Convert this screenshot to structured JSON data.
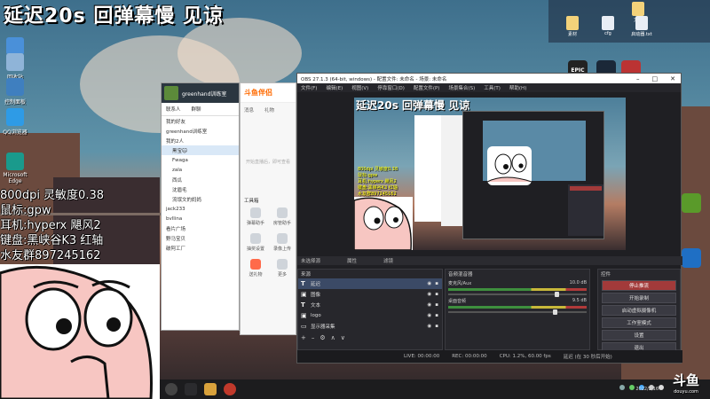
{
  "overlay": {
    "title": "延迟20s 回弹幕慢 见谅",
    "specs": [
      "800dpi 灵敏度0.38",
      "鼠标:gpw",
      "耳机:hyperx 飓风2",
      "键盘:黑峡谷K3 红轴",
      "水友群897245162"
    ]
  },
  "desktop_icons": [
    {
      "label": "此电脑",
      "icon": "computer-icon",
      "color": "#4a90d9"
    },
    {
      "label": "回收站",
      "icon": "recycle-bin-icon",
      "color": "#8fb4d8"
    },
    {
      "label": "控制面板",
      "icon": "control-panel-icon",
      "color": "#3f7fbf"
    },
    {
      "label": "QQ浏览器",
      "icon": "qq-browser-icon",
      "color": "#2e9be6"
    },
    {
      "label": "Microsoft Edge",
      "icon": "edge-icon",
      "color": "#1a9a8c"
    }
  ],
  "tray_files": [
    {
      "label": "文件",
      "icon": "folder-icon"
    },
    {
      "label": "素材",
      "icon": "folder-icon"
    },
    {
      "label": "cfg",
      "icon": "file-icon"
    },
    {
      "label": "启动器.txt",
      "icon": "text-file-icon"
    }
  ],
  "game_icons": [
    {
      "name": "epic-games-icon",
      "label": "EPIC",
      "color": "#222"
    },
    {
      "name": "steam-icon",
      "label": "",
      "color": "#1b2838"
    },
    {
      "name": "game-launcher-icon",
      "label": "",
      "color": "#b33"
    },
    {
      "name": "nvidia-icon",
      "label": "",
      "color": "#5a9a2a"
    },
    {
      "name": "teamviewer-icon",
      "label": "",
      "color": "#1f6fc4"
    }
  ],
  "qq": {
    "name": "greenhand训练室",
    "tabs": [
      "联系人",
      "群聊"
    ],
    "rows": [
      "我的好友",
      "greenhand训练室",
      "我的2人",
      "黑宝🐱",
      "Fwaga",
      "zala",
      "西瓜",
      "沈眉毛",
      "流氓文的妈妈",
      "jack233",
      "bvllina",
      "看片广场",
      "野马宝贝",
      "破阿工厂"
    ]
  },
  "assistant": {
    "logo": "斗鱼伴侣",
    "tabs": [
      "消息",
      "礼物"
    ],
    "placeholder": "开始直播后，即可查看",
    "section": "工具箱",
    "tools": [
      "弹幕助手",
      "房管助手",
      "抽奖设置",
      "录像上传",
      "送礼物",
      "更多"
    ]
  },
  "obs": {
    "title": "OBS 27.1.3 (64-bit, windows) - 配置文件: 未命名 - 场景: 未命名",
    "menu": [
      "文件(F)",
      "编辑(E)",
      "视图(V)",
      "停靠窗口(D)",
      "配置文件(P)",
      "场景集合(S)",
      "工具(T)",
      "帮助(H)"
    ],
    "dock_bar": [
      "未选择源",
      "属性",
      "滤镜"
    ],
    "sources_title": "来源",
    "sources": [
      "延迟",
      "图像",
      "文本",
      "logo",
      "显示器采集"
    ],
    "mixer_title": "音频混音器",
    "mixer": [
      {
        "name": "麦克风/Aux",
        "db": "10.0 dB"
      },
      {
        "name": "桌面音频",
        "db": "9.5 dB"
      }
    ],
    "controls_title": "控件",
    "controls": [
      "停止推流",
      "开始录制",
      "启动虚拟摄像机",
      "工作室模式",
      "设置",
      "退出"
    ],
    "status": [
      "LIVE: 00:00:00",
      "REC: 00:00:00",
      "CPU: 1.2%, 60.00 fps",
      "延迟 (在 30 秒后开始)"
    ]
  },
  "taskbar": {
    "clock": "2022/2/16"
  },
  "watermark": {
    "logo": "斗鱼",
    "sub": "douyu.com"
  }
}
